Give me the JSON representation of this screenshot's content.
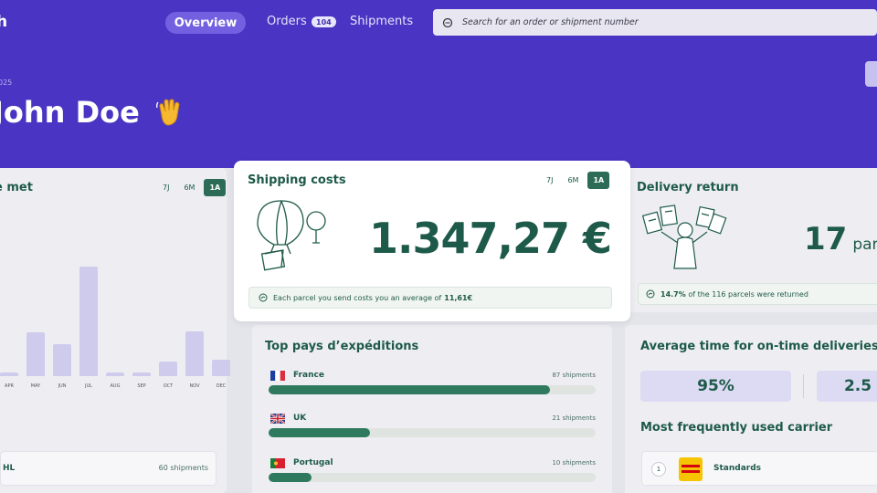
{
  "header": {
    "logo_fragment": "h",
    "nav": {
      "overview": "Overview",
      "orders": "Orders",
      "orders_badge": "104",
      "shipments": "Shipments"
    },
    "search_placeholder": "Search for an order or shipment number",
    "date_fragment": "025",
    "greeting": "John Doe"
  },
  "ranges": [
    "7J",
    "6M",
    "1A"
  ],
  "left_card": {
    "title_fragment": "e met",
    "months": [
      "APR",
      "MAY",
      "JUN",
      "JUL",
      "AUG",
      "SEP",
      "OCT",
      "NOV",
      "DEC"
    ],
    "bar_levels": [
      0.03,
      0.4,
      0.29,
      1.0,
      0.03,
      0.03,
      0.13,
      0.41,
      0.15
    ],
    "carrier_label": "HL",
    "carrier_count": "60 shipments"
  },
  "shipping_costs": {
    "title": "Shipping costs",
    "amount": "1.347,27 €",
    "info_prefix": "Each parcel you send costs you an average of",
    "info_value": "11,61€"
  },
  "delivery_return": {
    "title": "Delivery return",
    "count": "17",
    "unit_fragment": "parc",
    "info_percent": "14.7%",
    "info_text": "of the 116 parcels were returned"
  },
  "top_countries": {
    "title": "Top pays d’expéditions",
    "items": [
      {
        "name": "France",
        "count": "87 shipments",
        "share": 0.86
      },
      {
        "name": "UK",
        "count": "21 shipments",
        "share": 0.31
      },
      {
        "name": "Portugal",
        "count": "10 shipments",
        "share": 0.13
      }
    ]
  },
  "average_time": {
    "title": "Average time for on-time deliveries",
    "stat1": "95%",
    "stat2_fragment": "2.5",
    "carrier_title": "Most frequently used carrier",
    "carrier_rank": "1",
    "carrier_label": "Standards"
  },
  "colors": {
    "hero": "#4a34c3",
    "accent_green": "#2c6c57",
    "text_green": "#1e5a49",
    "bar": "#cfcbed"
  }
}
